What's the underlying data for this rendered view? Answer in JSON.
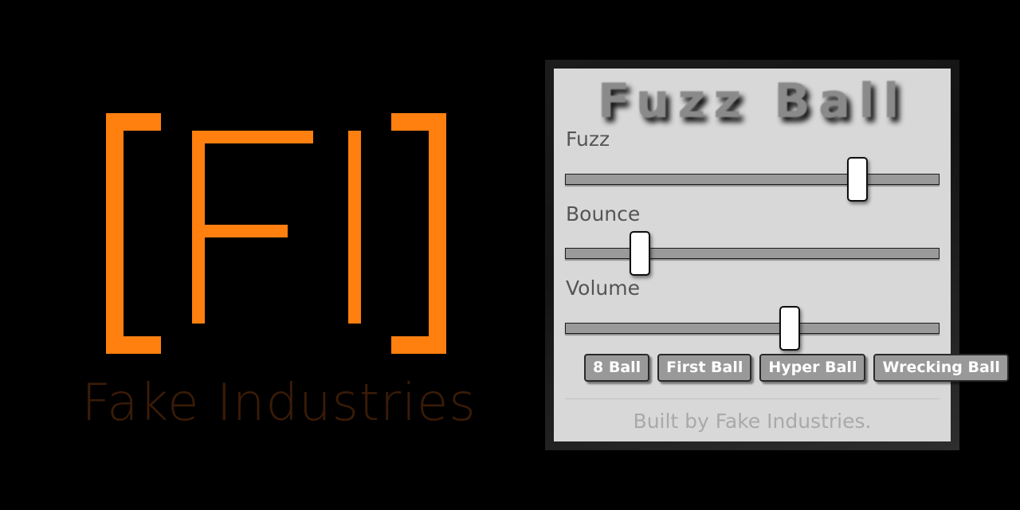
{
  "colors": {
    "brand_orange": "#ff7f0f",
    "wordmark": "#3a1b06",
    "panel_bg": "#d8d8d8",
    "frame": "#1c1c1c",
    "title_gray": "#8a8a8a",
    "label_gray": "#555555",
    "button_gray": "#999999",
    "footer_gray": "#a9a9a9",
    "track_gray": "#9a9a9a",
    "thumb_white": "#ffffff"
  },
  "brand": {
    "logo_text": "[FI]",
    "wordmark": "Fake Industries"
  },
  "app": {
    "title": "Fuzz Ball",
    "footer": "Built by Fake Industries.",
    "controls": [
      {
        "label": "Fuzz",
        "value": 78,
        "min": 0,
        "max": 100
      },
      {
        "label": "Bounce",
        "value": 20,
        "min": 0,
        "max": 100
      },
      {
        "label": "Volume",
        "value": 60,
        "min": 0,
        "max": 100
      }
    ],
    "buttons": [
      {
        "label": "8 Ball"
      },
      {
        "label": "First Ball"
      },
      {
        "label": "Hyper Ball"
      },
      {
        "label": "Wrecking Ball"
      }
    ]
  }
}
